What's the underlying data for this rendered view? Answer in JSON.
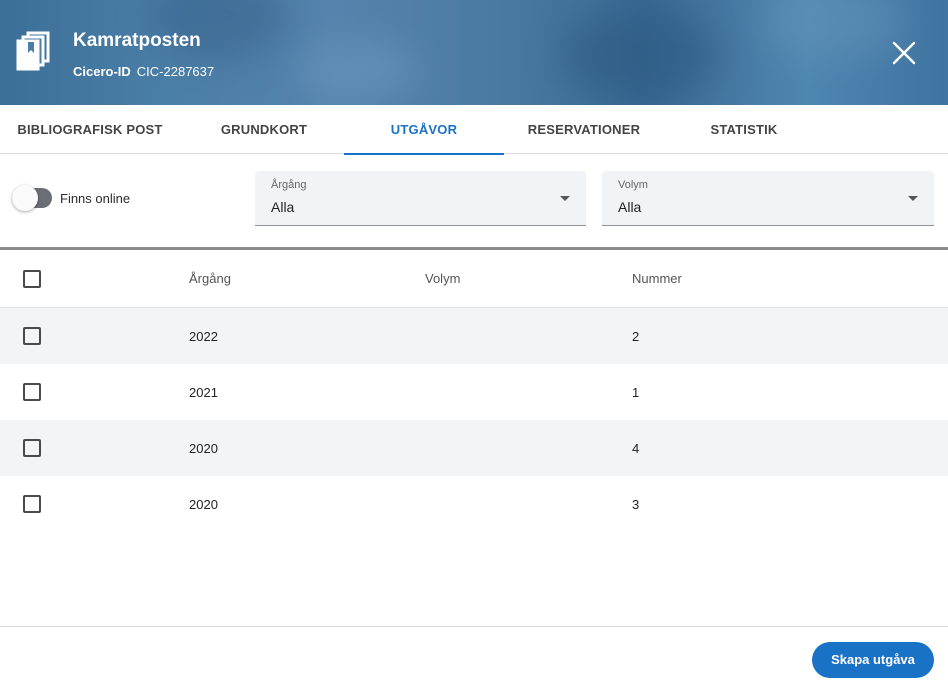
{
  "header": {
    "title": "Kamratposten",
    "id_label": "Cicero-ID",
    "id_value": "CIC-2287637"
  },
  "tabs": [
    {
      "label": "BIBLIOGRAFISK POST",
      "active": false
    },
    {
      "label": "GRUNDKORT",
      "active": false
    },
    {
      "label": "UTGÅVOR",
      "active": true
    },
    {
      "label": "RESERVATIONER",
      "active": false
    },
    {
      "label": "STATISTIK",
      "active": false
    }
  ],
  "filters": {
    "online_toggle_label": "Finns online",
    "year_select": {
      "label": "Årgång",
      "value": "Alla"
    },
    "volume_select": {
      "label": "Volym",
      "value": "Alla"
    }
  },
  "table": {
    "columns": [
      "Årgång",
      "Volym",
      "Nummer"
    ],
    "rows": [
      {
        "year": "2022",
        "volume": "",
        "number": "2"
      },
      {
        "year": "2021",
        "volume": "",
        "number": "1"
      },
      {
        "year": "2020",
        "volume": "",
        "number": "4"
      },
      {
        "year": "2020",
        "volume": "",
        "number": "3"
      }
    ]
  },
  "actions": {
    "create_label": "Skapa utgåva"
  },
  "colors": {
    "accent": "#1a72c7",
    "header_bg": "#4a7fa8"
  },
  "icons": {
    "document": "document-stack-icon",
    "close": "close-icon"
  }
}
